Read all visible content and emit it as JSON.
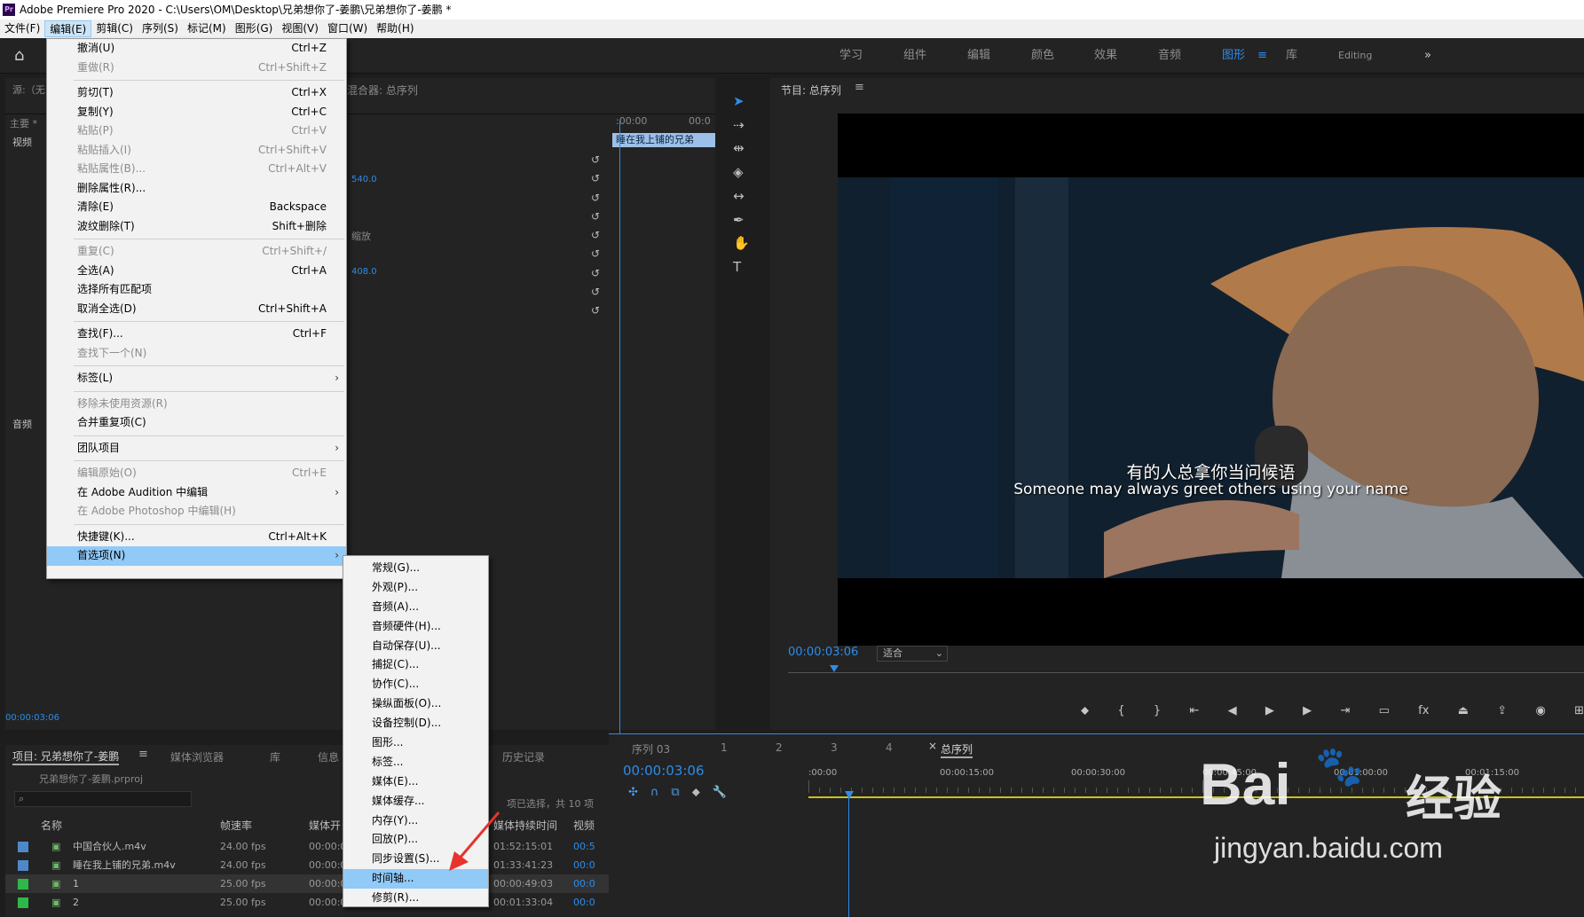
{
  "window": {
    "title": "Adobe Premiere Pro 2020 - C:\\Users\\OM\\Desktop\\兄弟想你了-姜鹏\\兄弟想你了-姜鹏 *"
  },
  "menubar": [
    "文件(F)",
    "编辑(E)",
    "剪辑(C)",
    "序列(S)",
    "标记(M)",
    "图形(G)",
    "视图(V)",
    "窗口(W)",
    "帮助(H)"
  ],
  "workspaces": [
    "学习",
    "组件",
    "编辑",
    "颜色",
    "效果",
    "音频",
    "图形",
    "库",
    "Editing"
  ],
  "edit_menu": {
    "items": [
      {
        "label": "撤消(U)",
        "shortcut": "Ctrl+Z"
      },
      {
        "label": "重做(R)",
        "shortcut": "Ctrl+Shift+Z"
      },
      {
        "label": "剪切(T)",
        "shortcut": "Ctrl+X"
      },
      {
        "label": "复制(Y)",
        "shortcut": "Ctrl+C"
      },
      {
        "label": "粘贴(P)",
        "shortcut": "Ctrl+V"
      },
      {
        "label": "粘贴插入(I)",
        "shortcut": "Ctrl+Shift+V"
      },
      {
        "label": "粘贴属性(B)...",
        "shortcut": "Ctrl+Alt+V"
      },
      {
        "label": "删除属性(R)...",
        "shortcut": ""
      },
      {
        "label": "清除(E)",
        "shortcut": "Backspace"
      },
      {
        "label": "波纹删除(T)",
        "shortcut": "Shift+删除"
      },
      {
        "label": "重复(C)",
        "shortcut": "Ctrl+Shift+/"
      },
      {
        "label": "全选(A)",
        "shortcut": "Ctrl+A"
      },
      {
        "label": "选择所有匹配项",
        "shortcut": ""
      },
      {
        "label": "取消全选(D)",
        "shortcut": "Ctrl+Shift+A"
      },
      {
        "label": "查找(F)...",
        "shortcut": "Ctrl+F"
      },
      {
        "label": "查找下一个(N)",
        "shortcut": ""
      },
      {
        "label": "标签(L)",
        "shortcut": ""
      },
      {
        "label": "移除未使用资源(R)",
        "shortcut": ""
      },
      {
        "label": "合并重复项(C)",
        "shortcut": ""
      },
      {
        "label": "团队项目",
        "shortcut": ""
      },
      {
        "label": "编辑原始(O)",
        "shortcut": "Ctrl+E"
      },
      {
        "label": "在 Adobe Audition 中编辑",
        "shortcut": ""
      },
      {
        "label": "在 Adobe Photoshop 中编辑(H)",
        "shortcut": ""
      },
      {
        "label": "快捷键(K)...",
        "shortcut": "Ctrl+Alt+K"
      },
      {
        "label": "首选项(N)",
        "shortcut": ""
      }
    ],
    "arrow": "›"
  },
  "prefs_submenu": [
    "常规(G)...",
    "外观(P)...",
    "音频(A)...",
    "音频硬件(H)...",
    "自动保存(U)...",
    "捕捉(C)...",
    "协作(C)...",
    "操纵面板(O)...",
    "设备控制(D)...",
    "图形...",
    "标签...",
    "媒体(E)...",
    "媒体缓存...",
    "内存(Y)...",
    "回放(P)...",
    "同步设置(S)...",
    "时间轴...",
    "修剪(R)..."
  ],
  "source_panel": {
    "tab": "源:（无",
    "mixer": "混合器: 总序列",
    "clip": "睡在我上铺的兄弟",
    "v1": "540.0",
    "v2": "408.0",
    "scale_label": "缩放",
    "t1": ":00:00",
    "t2": "00:0",
    "time": "00:00:03:06",
    "main": "主要 *",
    "video": "视频",
    "audio": "音频"
  },
  "program": {
    "title": "节目: 总序列",
    "timecode": "00:00:03:06",
    "fit": "适合",
    "subtitle_cn": "有的人总拿你当问候语",
    "subtitle_en": "Someone may always greet others using your name"
  },
  "project": {
    "tabs": [
      "项目: 兄弟想你了-姜鹏",
      "媒体浏览器",
      "库",
      "信息",
      "历史记录"
    ],
    "file": "兄弟想你了-姜鹏.prproj",
    "selection": "项已选择，共 10 项",
    "cols": [
      "名称",
      "帧速率",
      "媒体开",
      "媒体持续时间",
      "视频"
    ],
    "rows": [
      {
        "name": "中国合伙人.m4v",
        "fps": "24.00 fps",
        "start": "00:00:0",
        "dur": "01:52:15:01",
        "v": "00:5",
        "color": "#4f88c9"
      },
      {
        "name": "睡在我上铺的兄弟.m4v",
        "fps": "24.00 fps",
        "start": "00:00:0",
        "dur": "01:33:41:23",
        "v": "00:0",
        "color": "#4f88c9"
      },
      {
        "name": "1",
        "fps": "25.00 fps",
        "start": "00:00:0",
        "dur": "00:00:49:03",
        "v": "00:0",
        "color": "#2eb84a"
      },
      {
        "name": "2",
        "fps": "25.00 fps",
        "start": "00:00:0",
        "dur": "00:01:33:04",
        "v": "00:0",
        "color": "#2eb84a"
      }
    ]
  },
  "timeline": {
    "tabs": [
      "序列 03",
      "1",
      "2",
      "3",
      "4",
      "总序列"
    ],
    "timecode": "00:00:03:06",
    "ruler": [
      ":00:00",
      "00:00:15:00",
      "00:00:30:00",
      "00:00:45:00",
      "00:01:00:00",
      "00:01:15:00",
      "00:"
    ]
  },
  "watermark": {
    "brand": "Bai",
    "brand2": "经验",
    "url": "jingyan.baidu.com"
  },
  "colors": {
    "accent": "#2d8ceb",
    "menu_highlight": "#91c9f7",
    "arrow": "#e8322c"
  }
}
